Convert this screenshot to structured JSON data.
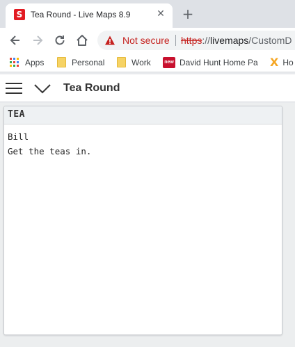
{
  "browser": {
    "tab": {
      "favicon_letter": "S",
      "title": "Tea Round - Live Maps 8.9",
      "close_glyph": "✕"
    },
    "new_tab_glyph": "+",
    "security": {
      "label": "Not secure"
    },
    "url": {
      "scheme": "https",
      "separator": "://",
      "host": "livemaps",
      "path": "/CustomD"
    },
    "bookmarks": [
      {
        "label": "Apps",
        "icon": "apps-grid-icon"
      },
      {
        "label": "Personal",
        "icon": "folder-icon"
      },
      {
        "label": "Work",
        "icon": "folder-icon"
      },
      {
        "label": "David Hunt Home Pa",
        "icon": "new-badge-icon",
        "badge": "new"
      },
      {
        "label": "Ho",
        "icon": "x-logo-icon",
        "glyph": "X"
      }
    ]
  },
  "app": {
    "title": "Tea Round"
  },
  "panel": {
    "title": "TEA",
    "lines": [
      "Bill",
      "Get the teas in."
    ]
  },
  "colors": {
    "favicon": "#e21b23",
    "not_secure": "#c5221f",
    "folder": "#f6d365",
    "badge": "#c8102e",
    "x_logo": "#f5a623"
  }
}
